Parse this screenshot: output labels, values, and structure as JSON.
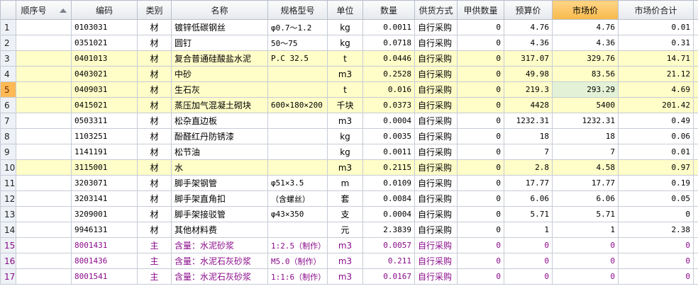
{
  "columns": [
    {
      "label": "",
      "key": "rn"
    },
    {
      "label": "顺序号",
      "key": "seq"
    },
    {
      "label": "编码",
      "key": "code"
    },
    {
      "label": "类别",
      "key": "cat"
    },
    {
      "label": "名称",
      "key": "name"
    },
    {
      "label": "规格型号",
      "key": "spec"
    },
    {
      "label": "单位",
      "key": "unit"
    },
    {
      "label": "数量",
      "key": "qty"
    },
    {
      "label": "供货方式",
      "key": "supply"
    },
    {
      "label": "甲供数量",
      "key": "owner_qty"
    },
    {
      "label": "预算价",
      "key": "budget"
    },
    {
      "label": "市场价",
      "key": "market"
    },
    {
      "label": "市场价合计",
      "key": "market_total"
    },
    {
      "label": "市",
      "key": "extra"
    }
  ],
  "rows": [
    {
      "rn": "1",
      "seq": "",
      "code": "0103031",
      "cat": "材",
      "name": "镀锌低碳钢丝",
      "spec": "φ0.7～1.2",
      "unit": "kg",
      "qty": "0.0011",
      "supply": "自行采购",
      "owner_qty": "0",
      "budget": "4.76",
      "market": "4.76",
      "market_total": "0.01",
      "extra": "",
      "highlight": false,
      "purple": false
    },
    {
      "rn": "2",
      "seq": "",
      "code": "0351021",
      "cat": "材",
      "name": "圆钉",
      "spec": "50～75",
      "unit": "kg",
      "qty": "0.0718",
      "supply": "自行采购",
      "owner_qty": "0",
      "budget": "4.36",
      "market": "4.36",
      "market_total": "0.31",
      "extra": "",
      "highlight": false,
      "purple": false
    },
    {
      "rn": "3",
      "seq": "",
      "code": "0401013",
      "cat": "材",
      "name": "复合普通硅酸盐水泥",
      "spec": "P.C 32.5",
      "unit": "t",
      "qty": "0.0446",
      "supply": "自行采购",
      "owner_qty": "0",
      "budget": "317.07",
      "market": "329.76",
      "market_total": "14.71",
      "extra": "",
      "highlight": true,
      "purple": false
    },
    {
      "rn": "4",
      "seq": "",
      "code": "0403021",
      "cat": "材",
      "name": "中砂",
      "spec": "",
      "unit": "m3",
      "qty": "0.2528",
      "supply": "自行采购",
      "owner_qty": "0",
      "budget": "49.98",
      "market": "83.56",
      "market_total": "21.12",
      "extra": "",
      "highlight": true,
      "purple": false
    },
    {
      "rn": "5",
      "seq": "",
      "code": "0409031",
      "cat": "材",
      "name": "生石灰",
      "spec": "",
      "unit": "t",
      "qty": "0.016",
      "supply": "自行采购",
      "owner_qty": "0",
      "budget": "219.3",
      "market": "293.29",
      "market_total": "4.69",
      "extra": "",
      "highlight": true,
      "purple": false,
      "selected": true
    },
    {
      "rn": "6",
      "seq": "",
      "code": "0415021",
      "cat": "材",
      "name": "蒸压加气混凝土砌块",
      "spec": "600×180×200",
      "unit": "千块",
      "qty": "0.0373",
      "supply": "自行采购",
      "owner_qty": "0",
      "budget": "4428",
      "market": "5400",
      "market_total": "201.42",
      "extra": "",
      "highlight": true,
      "purple": false
    },
    {
      "rn": "7",
      "seq": "",
      "code": "0503311",
      "cat": "材",
      "name": "松杂直边板",
      "spec": "",
      "unit": "m3",
      "qty": "0.0004",
      "supply": "自行采购",
      "owner_qty": "0",
      "budget": "1232.31",
      "market": "1232.31",
      "market_total": "0.49",
      "extra": "",
      "highlight": false,
      "purple": false
    },
    {
      "rn": "8",
      "seq": "",
      "code": "1103251",
      "cat": "材",
      "name": "酚醛红丹防锈漆",
      "spec": "",
      "unit": "kg",
      "qty": "0.0035",
      "supply": "自行采购",
      "owner_qty": "0",
      "budget": "18",
      "market": "18",
      "market_total": "0.06",
      "extra": "",
      "highlight": false,
      "purple": false
    },
    {
      "rn": "9",
      "seq": "",
      "code": "1141191",
      "cat": "材",
      "name": "松节油",
      "spec": "",
      "unit": "kg",
      "qty": "0.0011",
      "supply": "自行采购",
      "owner_qty": "0",
      "budget": "7",
      "market": "7",
      "market_total": "0.01",
      "extra": "",
      "highlight": false,
      "purple": false
    },
    {
      "rn": "10",
      "seq": "",
      "code": "3115001",
      "cat": "材",
      "name": "水",
      "spec": "",
      "unit": "m3",
      "qty": "0.2115",
      "supply": "自行采购",
      "owner_qty": "0",
      "budget": "2.8",
      "market": "4.58",
      "market_total": "0.97",
      "extra": "",
      "highlight": true,
      "purple": false
    },
    {
      "rn": "11",
      "seq": "",
      "code": "3203071",
      "cat": "材",
      "name": "脚手架钢管",
      "spec": "φ51×3.5",
      "unit": "m",
      "qty": "0.0109",
      "supply": "自行采购",
      "owner_qty": "0",
      "budget": "17.77",
      "market": "17.77",
      "market_total": "0.19",
      "extra": "",
      "highlight": false,
      "purple": false
    },
    {
      "rn": "12",
      "seq": "",
      "code": "3203141",
      "cat": "材",
      "name": "脚手架直角扣",
      "spec": "（含螺丝）",
      "unit": "套",
      "qty": "0.0084",
      "supply": "自行采购",
      "owner_qty": "0",
      "budget": "6.06",
      "market": "6.06",
      "market_total": "0.05",
      "extra": "",
      "highlight": false,
      "purple": false
    },
    {
      "rn": "13",
      "seq": "",
      "code": "3209001",
      "cat": "材",
      "name": "脚手架接驳管",
      "spec": "φ43×350",
      "unit": "支",
      "qty": "0.0004",
      "supply": "自行采购",
      "owner_qty": "0",
      "budget": "5.71",
      "market": "5.71",
      "market_total": "0",
      "extra": "",
      "highlight": false,
      "purple": false
    },
    {
      "rn": "14",
      "seq": "",
      "code": "9946131",
      "cat": "材",
      "name": "其他材料费",
      "spec": "",
      "unit": "元",
      "qty": "2.3839",
      "supply": "自行采购",
      "owner_qty": "0",
      "budget": "1",
      "market": "1",
      "market_total": "2.38",
      "extra": "",
      "highlight": false,
      "purple": false
    },
    {
      "rn": "15",
      "seq": "",
      "code": "8001431",
      "cat": "主",
      "name": "含量：水泥砂浆",
      "spec": "1:2.5（制作）",
      "unit": "m3",
      "qty": "0.0057",
      "supply": "自行采购",
      "owner_qty": "0",
      "budget": "0",
      "market": "0",
      "market_total": "0",
      "extra": "",
      "highlight": false,
      "purple": true
    },
    {
      "rn": "16",
      "seq": "",
      "code": "8001436",
      "cat": "主",
      "name": "含量：水泥石灰砂浆",
      "spec": "M5.0（制作）",
      "unit": "m3",
      "qty": "0.211",
      "supply": "自行采购",
      "owner_qty": "0",
      "budget": "0",
      "market": "0",
      "market_total": "0",
      "extra": "",
      "highlight": false,
      "purple": true
    },
    {
      "rn": "17",
      "seq": "",
      "code": "8001541",
      "cat": "主",
      "name": "含量：水泥石灰砂浆",
      "spec": "1:1:6（制作）",
      "unit": "m3",
      "qty": "0.0167",
      "supply": "自行采购",
      "owner_qty": "0",
      "budget": "0",
      "market": "0",
      "market_total": "0",
      "extra": "",
      "highlight": false,
      "purple": true
    }
  ]
}
